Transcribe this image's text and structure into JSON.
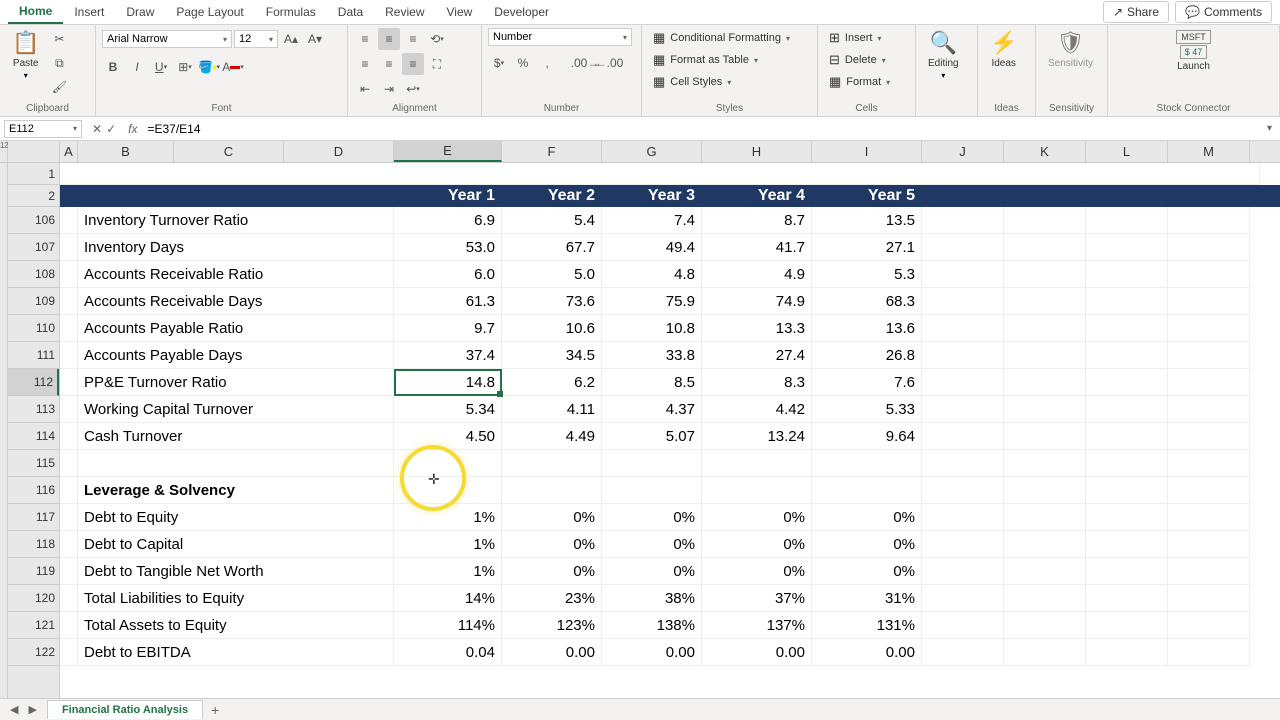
{
  "tabs": [
    "Home",
    "Insert",
    "Draw",
    "Page Layout",
    "Formulas",
    "Data",
    "Review",
    "View",
    "Developer"
  ],
  "share": "Share",
  "comments": "Comments",
  "clipboard": {
    "paste": "Paste",
    "label": "Clipboard"
  },
  "font": {
    "name": "Arial Narrow",
    "size": "12",
    "label": "Font"
  },
  "alignment": {
    "label": "Alignment"
  },
  "number": {
    "format": "Number",
    "label": "Number"
  },
  "styles": {
    "cf": "Conditional Formatting",
    "fat": "Format as Table",
    "cs": "Cell Styles",
    "label": "Styles"
  },
  "cells": {
    "insert": "Insert",
    "delete": "Delete",
    "format": "Format",
    "label": "Cells"
  },
  "editing": {
    "label": "Editing"
  },
  "ideas": {
    "btn": "Ideas",
    "label": "Ideas"
  },
  "sensitivity": {
    "btn": "Sensitivity",
    "label": "Sensitivity"
  },
  "stock": {
    "ticker": "MSFT",
    "price": "$ 47",
    "btn": "Launch",
    "label": "Stock Connector"
  },
  "nameBox": "E112",
  "formula": "=E37/E14",
  "columns": [
    "A",
    "B",
    "C",
    "D",
    "E",
    "F",
    "G",
    "H",
    "I",
    "J",
    "K",
    "L",
    "M"
  ],
  "rows": [
    "1",
    "2",
    "106",
    "107",
    "108",
    "109",
    "110",
    "111",
    "112",
    "113",
    "114",
    "115",
    "116",
    "117",
    "118",
    "119",
    "120",
    "121",
    "122"
  ],
  "headerRow": {
    "E": "Year 1",
    "F": "Year 2",
    "G": "Year 3",
    "H": "Year 4",
    "I": "Year 5"
  },
  "data": {
    "106": {
      "label": "Inventory Turnover Ratio",
      "E": "6.9",
      "F": "5.4",
      "G": "7.4",
      "H": "8.7",
      "I": "13.5"
    },
    "107": {
      "label": "Inventory Days",
      "E": "53.0",
      "F": "67.7",
      "G": "49.4",
      "H": "41.7",
      "I": "27.1"
    },
    "108": {
      "label": "Accounts Receivable Ratio",
      "E": "6.0",
      "F": "5.0",
      "G": "4.8",
      "H": "4.9",
      "I": "5.3"
    },
    "109": {
      "label": "Accounts Receivable Days",
      "E": "61.3",
      "F": "73.6",
      "G": "75.9",
      "H": "74.9",
      "I": "68.3"
    },
    "110": {
      "label": "Accounts Payable Ratio",
      "E": "9.7",
      "F": "10.6",
      "G": "10.8",
      "H": "13.3",
      "I": "13.6"
    },
    "111": {
      "label": "Accounts Payable Days",
      "E": "37.4",
      "F": "34.5",
      "G": "33.8",
      "H": "27.4",
      "I": "26.8"
    },
    "112": {
      "label": "PP&E Turnover Ratio",
      "E": "14.8",
      "F": "6.2",
      "G": "8.5",
      "H": "8.3",
      "I": "7.6"
    },
    "113": {
      "label": "Working Capital Turnover",
      "E": "5.34",
      "F": "4.11",
      "G": "4.37",
      "H": "4.42",
      "I": "5.33"
    },
    "114": {
      "label": "Cash Turnover",
      "E": "4.50",
      "F": "4.49",
      "G": "5.07",
      "H": "13.24",
      "I": "9.64"
    },
    "116": {
      "label": "Leverage & Solvency"
    },
    "117": {
      "label": "Debt to Equity",
      "E": "1%",
      "F": "0%",
      "G": "0%",
      "H": "0%",
      "I": "0%"
    },
    "118": {
      "label": "Debt to Capital",
      "E": "1%",
      "F": "0%",
      "G": "0%",
      "H": "0%",
      "I": "0%"
    },
    "119": {
      "label": "Debt to Tangible Net Worth",
      "E": "1%",
      "F": "0%",
      "G": "0%",
      "H": "0%",
      "I": "0%"
    },
    "120": {
      "label": "Total Liabilities to Equity",
      "E": "14%",
      "F": "23%",
      "G": "38%",
      "H": "37%",
      "I": "31%"
    },
    "121": {
      "label": "Total Assets to Equity",
      "E": "114%",
      "F": "123%",
      "G": "138%",
      "H": "137%",
      "I": "131%"
    },
    "122": {
      "label": "Debt to EBITDA",
      "E": "0.04",
      "F": "0.00",
      "G": "0.00",
      "H": "0.00",
      "I": "0.00"
    }
  },
  "sheetTab": "Financial Ratio Analysis"
}
